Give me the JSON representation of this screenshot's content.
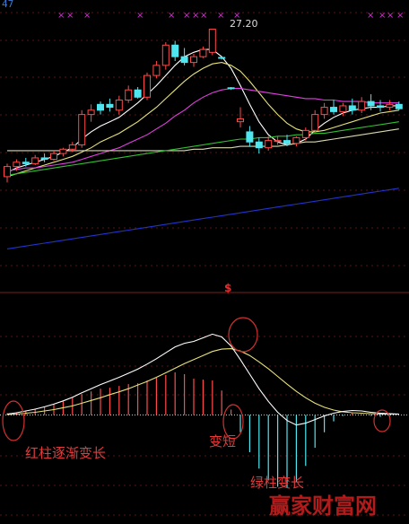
{
  "chart_data": [
    {
      "type": "candlestick",
      "panel": "price",
      "axis_label_left": "47",
      "high_label": "27.20",
      "candles": [
        {
          "o": 17.0,
          "h": 17.9,
          "l": 16.6,
          "c": 17.7,
          "up": true
        },
        {
          "o": 17.7,
          "h": 18.2,
          "l": 17.4,
          "c": 18.0,
          "up": true
        },
        {
          "o": 18.0,
          "h": 18.3,
          "l": 17.7,
          "c": 17.9,
          "up": false
        },
        {
          "o": 17.9,
          "h": 18.5,
          "l": 17.8,
          "c": 18.3,
          "up": true
        },
        {
          "o": 18.3,
          "h": 18.6,
          "l": 18.0,
          "c": 18.2,
          "up": false
        },
        {
          "o": 18.2,
          "h": 18.8,
          "l": 18.1,
          "c": 18.6,
          "up": true
        },
        {
          "o": 18.6,
          "h": 19.0,
          "l": 18.4,
          "c": 18.9,
          "up": true
        },
        {
          "o": 18.9,
          "h": 19.4,
          "l": 18.7,
          "c": 19.2,
          "up": true
        },
        {
          "o": 19.2,
          "h": 21.6,
          "l": 19.0,
          "c": 21.3,
          "up": true
        },
        {
          "o": 21.3,
          "h": 22.0,
          "l": 20.8,
          "c": 21.6,
          "up": true
        },
        {
          "o": 21.6,
          "h": 22.2,
          "l": 21.3,
          "c": 22.0,
          "up": false
        },
        {
          "o": 22.0,
          "h": 22.4,
          "l": 21.5,
          "c": 21.8,
          "up": false
        },
        {
          "o": 21.6,
          "h": 22.6,
          "l": 21.3,
          "c": 22.3,
          "up": true
        },
        {
          "o": 22.3,
          "h": 23.3,
          "l": 22.1,
          "c": 23.0,
          "up": true
        },
        {
          "o": 23.0,
          "h": 23.2,
          "l": 22.4,
          "c": 22.5,
          "up": false
        },
        {
          "o": 22.5,
          "h": 24.2,
          "l": 22.3,
          "c": 24.0,
          "up": true
        },
        {
          "o": 24.0,
          "h": 25.0,
          "l": 23.8,
          "c": 24.7,
          "up": true
        },
        {
          "o": 24.7,
          "h": 26.3,
          "l": 24.4,
          "c": 26.1,
          "up": true
        },
        {
          "o": 26.1,
          "h": 26.4,
          "l": 25.0,
          "c": 25.3,
          "up": false
        },
        {
          "o": 25.3,
          "h": 25.9,
          "l": 24.7,
          "c": 24.9,
          "up": false
        },
        {
          "o": 24.9,
          "h": 25.5,
          "l": 24.6,
          "c": 25.3,
          "up": true
        },
        {
          "o": 25.3,
          "h": 26.0,
          "l": 25.2,
          "c": 25.8,
          "up": true
        },
        {
          "o": 25.6,
          "h": 27.2,
          "l": 25.4,
          "c": 27.2,
          "up": true
        },
        {
          "o": 25.2,
          "h": 25.3,
          "l": 25.1,
          "c": 25.25,
          "up": false
        },
        {
          "o": 23.1,
          "h": 23.2,
          "l": 23.0,
          "c": 23.15,
          "up": false
        },
        {
          "o": 20.8,
          "h": 21.8,
          "l": 20.4,
          "c": 21.0,
          "up": true
        },
        {
          "o": 20.1,
          "h": 20.5,
          "l": 19.1,
          "c": 19.4,
          "up": false
        },
        {
          "o": 19.4,
          "h": 19.7,
          "l": 18.6,
          "c": 19.0,
          "up": false
        },
        {
          "o": 19.0,
          "h": 19.8,
          "l": 18.8,
          "c": 19.5,
          "up": true
        },
        {
          "o": 19.5,
          "h": 19.8,
          "l": 19.2,
          "c": 19.5,
          "up": true
        },
        {
          "o": 19.5,
          "h": 19.9,
          "l": 19.1,
          "c": 19.3,
          "up": false
        },
        {
          "o": 19.3,
          "h": 19.8,
          "l": 19.1,
          "c": 19.7,
          "up": true
        },
        {
          "o": 19.7,
          "h": 20.4,
          "l": 19.5,
          "c": 20.2,
          "up": true
        },
        {
          "o": 20.2,
          "h": 21.6,
          "l": 20.1,
          "c": 21.3,
          "up": true
        },
        {
          "o": 21.3,
          "h": 22.1,
          "l": 21.0,
          "c": 21.8,
          "up": true
        },
        {
          "o": 21.8,
          "h": 22.3,
          "l": 21.3,
          "c": 21.5,
          "up": false
        },
        {
          "o": 21.5,
          "h": 22.1,
          "l": 21.2,
          "c": 21.9,
          "up": true
        },
        {
          "o": 21.9,
          "h": 22.4,
          "l": 21.3,
          "c": 21.6,
          "up": false
        },
        {
          "o": 21.6,
          "h": 22.5,
          "l": 21.4,
          "c": 22.2,
          "up": true
        },
        {
          "o": 22.2,
          "h": 22.7,
          "l": 21.6,
          "c": 21.9,
          "up": false
        },
        {
          "o": 21.9,
          "h": 22.3,
          "l": 21.5,
          "c": 21.8,
          "up": false
        },
        {
          "o": 21.8,
          "h": 22.3,
          "l": 21.6,
          "c": 22.0,
          "up": true
        },
        {
          "o": 22.0,
          "h": 22.2,
          "l": 21.6,
          "c": 21.7,
          "up": false
        }
      ],
      "moving_averages": [
        {
          "color": "#ffffff",
          "values": [
            17.3,
            17.6,
            17.8,
            18.0,
            18.2,
            18.4,
            18.7,
            19.0,
            19.6,
            20.1,
            20.5,
            20.8,
            21.1,
            21.6,
            22.1,
            22.7,
            23.3,
            24.0,
            24.7,
            25.3,
            25.6,
            25.8,
            25.8,
            25.3,
            24.5,
            23.3,
            22.0,
            20.8,
            19.9,
            19.4,
            19.2,
            19.3,
            19.6,
            20.2,
            20.7,
            21.1,
            21.4,
            21.6,
            21.7,
            21.8,
            21.8,
            21.9,
            21.9
          ]
        },
        {
          "color": "#e7e27a",
          "values": [
            17.0,
            17.2,
            17.4,
            17.6,
            17.8,
            18.0,
            18.2,
            18.4,
            18.7,
            19.0,
            19.4,
            19.7,
            20.0,
            20.4,
            20.8,
            21.3,
            21.8,
            22.4,
            23.0,
            23.6,
            24.1,
            24.5,
            24.8,
            24.9,
            24.7,
            24.3,
            23.6,
            22.8,
            22.0,
            21.3,
            20.7,
            20.3,
            20.1,
            20.1,
            20.2,
            20.4,
            20.6,
            20.8,
            21.0,
            21.2,
            21.4,
            21.5,
            21.6
          ]
        },
        {
          "color": "#e040e0",
          "values": [
            17.4,
            17.5,
            17.6,
            17.6,
            17.7,
            17.8,
            17.9,
            18.0,
            18.2,
            18.4,
            18.6,
            18.8,
            19.0,
            19.3,
            19.6,
            19.9,
            20.3,
            20.7,
            21.2,
            21.6,
            22.1,
            22.5,
            22.8,
            23.0,
            23.1,
            23.1,
            23.0,
            22.9,
            22.8,
            22.7,
            22.6,
            22.5,
            22.4,
            22.4,
            22.3,
            22.3,
            22.2,
            22.2,
            22.2,
            22.1,
            22.1,
            22.1,
            22.1
          ]
        },
        {
          "color": "#d8d8b0",
          "values": [
            18.8,
            18.8,
            18.8,
            18.8,
            18.8,
            18.8,
            18.8,
            18.8,
            18.8,
            18.8,
            18.8,
            18.8,
            18.8,
            18.8,
            18.8,
            18.8,
            18.8,
            18.8,
            18.8,
            18.8,
            18.9,
            18.9,
            19.0,
            19.0,
            19.0,
            19.1,
            19.1,
            19.1,
            19.1,
            19.1,
            19.2,
            19.3,
            19.4,
            19.4,
            19.5,
            19.6,
            19.7,
            19.8,
            19.9,
            20.0,
            20.1,
            20.2,
            20.3
          ]
        },
        {
          "color": "#2fc02f",
          "values": [
            17.1,
            17.2,
            17.3,
            17.4,
            17.5,
            17.6,
            17.7,
            17.8,
            17.9,
            18.0,
            18.1,
            18.2,
            18.3,
            18.4,
            18.5,
            18.6,
            18.7,
            18.8,
            18.9,
            19.0,
            19.1,
            19.2,
            19.3,
            19.4,
            19.5,
            19.6,
            19.6,
            19.7,
            19.7,
            19.8,
            19.8,
            19.9,
            19.9,
            20.0,
            20.0,
            20.1,
            20.2,
            20.3,
            20.4,
            20.5,
            20.6,
            20.7,
            20.8
          ]
        },
        {
          "color": "#2233cc",
          "values": [
            12.0,
            12.1,
            12.2,
            12.3,
            12.4,
            12.5,
            12.6,
            12.7,
            12.8,
            12.9,
            13.0,
            13.1,
            13.2,
            13.3,
            13.4,
            13.5,
            13.6,
            13.7,
            13.8,
            13.9,
            14.0,
            14.1,
            14.2,
            14.3,
            14.4,
            14.5,
            14.6,
            14.7,
            14.8,
            14.9,
            15.0,
            15.1,
            15.2,
            15.3,
            15.4,
            15.5,
            15.6,
            15.7,
            15.8,
            15.9,
            16.0,
            16.1,
            16.2
          ]
        }
      ],
      "ylim": [
        10.6,
        28.6
      ]
    },
    {
      "type": "macd",
      "panel": "indicator",
      "title": "$",
      "dif": [
        0.02,
        0.05,
        0.09,
        0.13,
        0.18,
        0.24,
        0.31,
        0.39,
        0.49,
        0.58,
        0.67,
        0.75,
        0.83,
        0.92,
        1.01,
        1.12,
        1.24,
        1.37,
        1.5,
        1.58,
        1.62,
        1.7,
        1.78,
        1.72,
        1.52,
        1.22,
        0.9,
        0.58,
        0.3,
        0.06,
        -0.12,
        -0.22,
        -0.18,
        -0.1,
        -0.02,
        0.04,
        0.08,
        0.1,
        0.09,
        0.06,
        0.04,
        0.03,
        0.02
      ],
      "dea": [
        0.01,
        0.02,
        0.04,
        0.06,
        0.09,
        0.12,
        0.16,
        0.2,
        0.26,
        0.32,
        0.38,
        0.45,
        0.51,
        0.58,
        0.66,
        0.74,
        0.83,
        0.93,
        1.03,
        1.13,
        1.22,
        1.31,
        1.4,
        1.45,
        1.46,
        1.41,
        1.31,
        1.17,
        1.02,
        0.85,
        0.68,
        0.52,
        0.38,
        0.26,
        0.17,
        0.11,
        0.07,
        0.05,
        0.04,
        0.03,
        0.02,
        0.02,
        0.02
      ],
      "histogram": [
        0.04,
        0.06,
        0.1,
        0.14,
        0.18,
        0.24,
        0.3,
        0.38,
        0.46,
        0.52,
        0.58,
        0.6,
        0.64,
        0.68,
        0.7,
        0.76,
        0.82,
        0.88,
        0.94,
        0.9,
        0.8,
        0.78,
        0.76,
        0.54,
        0.12,
        -0.38,
        -0.82,
        -1.18,
        -1.44,
        -1.58,
        -1.6,
        -1.48,
        -1.12,
        -0.72,
        -0.38,
        -0.14,
        -0.02,
        0.04,
        0.02,
        -0.02,
        -0.04,
        -0.02,
        0.0
      ],
      "ylim": [
        -2.4,
        2.5
      ],
      "annotations": [
        "红柱逐渐变长",
        "变短",
        "绿柱变长"
      ]
    }
  ],
  "watermark": "赢家财富网"
}
